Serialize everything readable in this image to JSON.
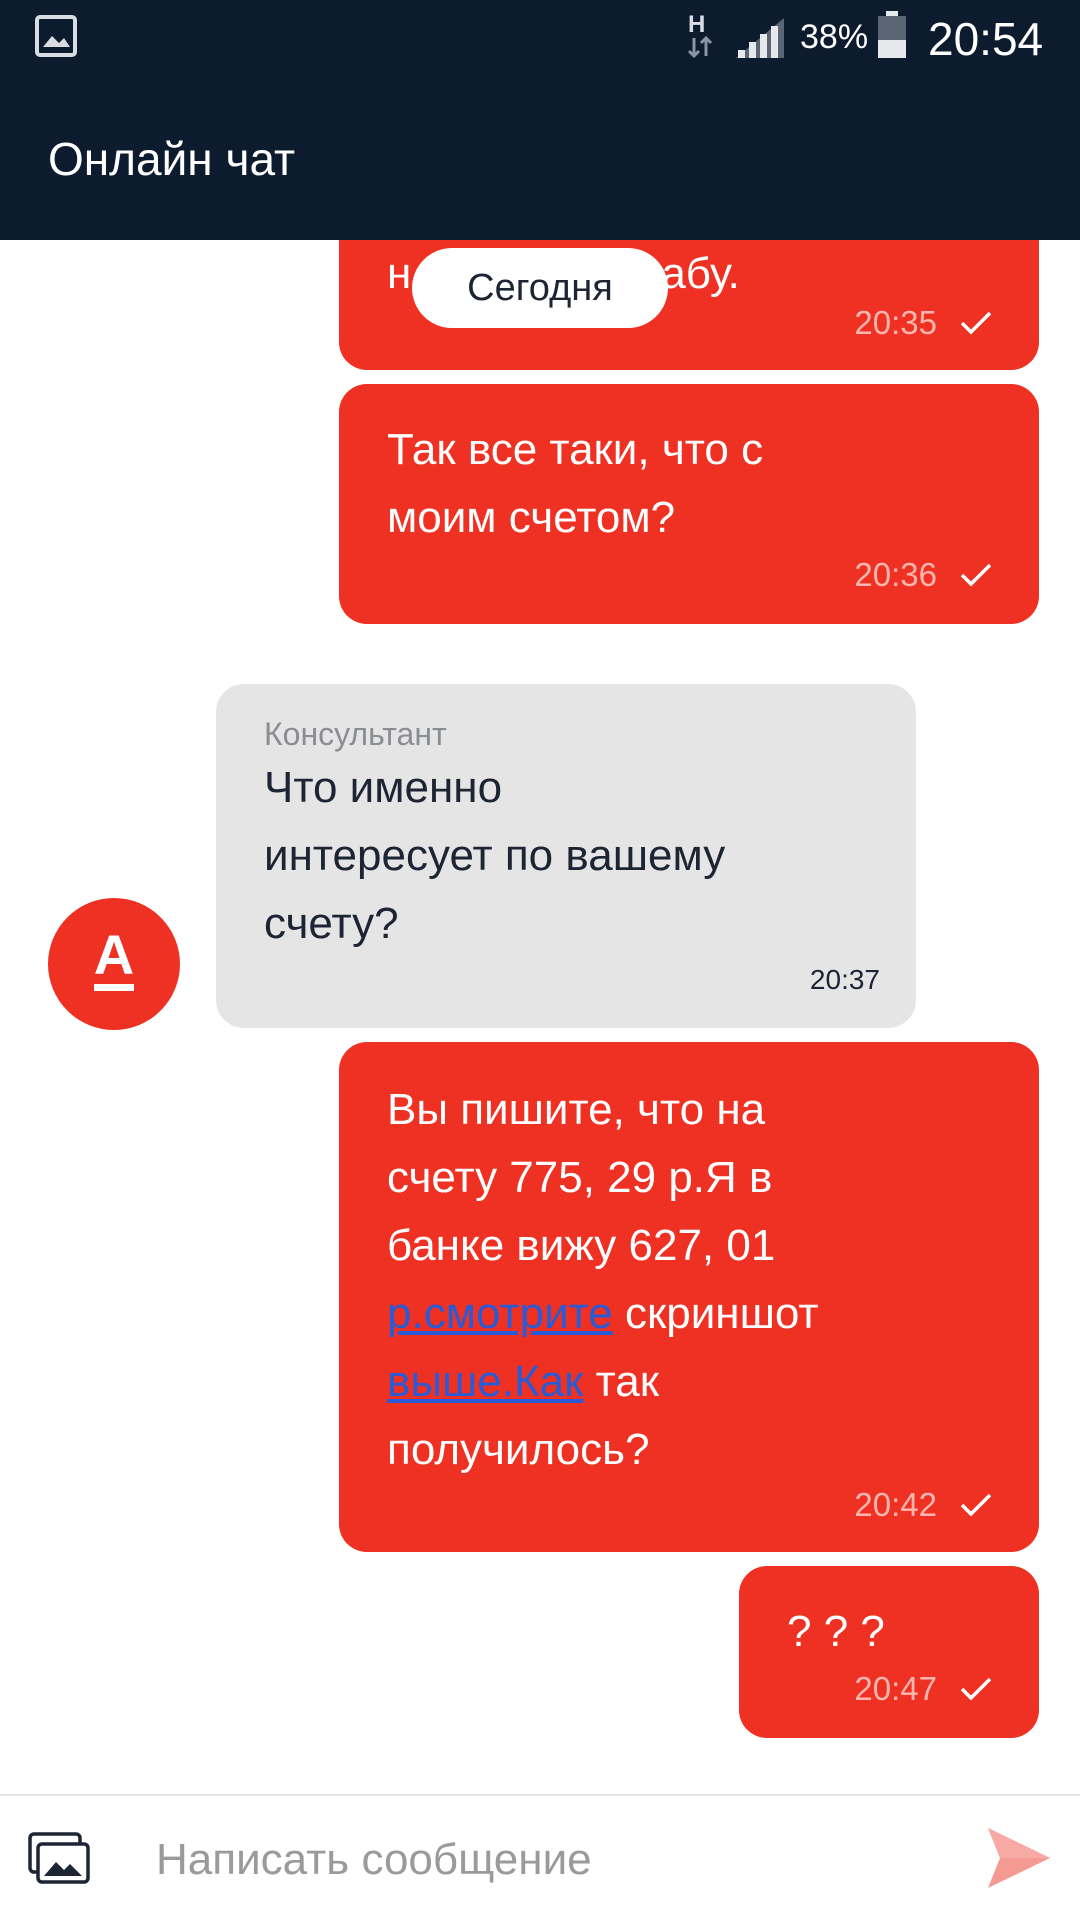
{
  "status_bar": {
    "network": "H",
    "battery": "38%",
    "time": "20:54"
  },
  "app_bar": {
    "title": "Онлайн чат"
  },
  "date_pill": "Сегодня",
  "messages": [
    {
      "text_partial_a": "н",
      "text_partial_b": "абу.",
      "time": "20:35"
    },
    {
      "lines": [
        "Так все таки, что с",
        "моим счетом?"
      ],
      "time": "20:36"
    },
    {
      "sender": "Консультант",
      "lines": [
        "Что именно",
        "интересует по вашему",
        "счету?"
      ],
      "time": "20:37"
    },
    {
      "line1": "Вы пишите, что на",
      "line2": "счету 775, 29 р.Я в",
      "line3": "банке вижу 627, 01",
      "link1": "р.смотрите",
      "line4_rest": " скриншот",
      "link2": "выше.Как",
      "line5_rest": " так",
      "line6": "получилось?",
      "time": "20:42"
    },
    {
      "text": "? ? ?",
      "time": "20:47"
    }
  ],
  "avatar_letter": "А",
  "input": {
    "placeholder": "Написать сообщение"
  },
  "colors": {
    "brand_red": "#ef3124",
    "header": "#0c1b2e",
    "incoming": "#e5e5e5",
    "link": "#2a5bd7"
  }
}
